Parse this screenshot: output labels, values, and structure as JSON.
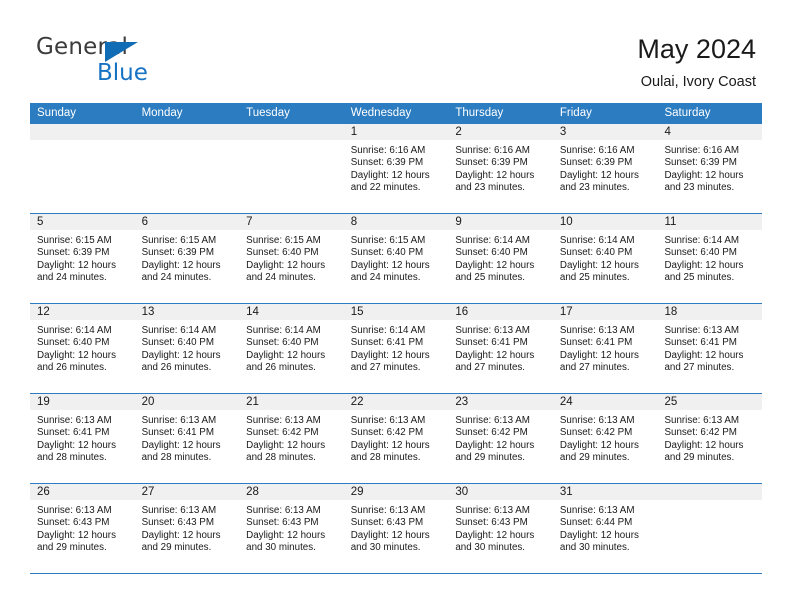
{
  "brand": {
    "line1": "General",
    "line2": "Blue",
    "accent_color": "#1673c4"
  },
  "header": {
    "title": "May 2024",
    "subtitle": "Oulai, Ivory Coast"
  },
  "theme": {
    "header_blue": "#2b7cc0",
    "band_gray": "#f0f0f0",
    "text": "#1a1a1a"
  },
  "weekdays": [
    "Sunday",
    "Monday",
    "Tuesday",
    "Wednesday",
    "Thursday",
    "Friday",
    "Saturday"
  ],
  "weeks": [
    [
      {
        "day": "",
        "lines": [
          "",
          "",
          "",
          ""
        ]
      },
      {
        "day": "",
        "lines": [
          "",
          "",
          "",
          ""
        ]
      },
      {
        "day": "",
        "lines": [
          "",
          "",
          "",
          ""
        ]
      },
      {
        "day": "1",
        "lines": [
          "Sunrise: 6:16 AM",
          "Sunset: 6:39 PM",
          "Daylight: 12 hours",
          "and 22 minutes."
        ]
      },
      {
        "day": "2",
        "lines": [
          "Sunrise: 6:16 AM",
          "Sunset: 6:39 PM",
          "Daylight: 12 hours",
          "and 23 minutes."
        ]
      },
      {
        "day": "3",
        "lines": [
          "Sunrise: 6:16 AM",
          "Sunset: 6:39 PM",
          "Daylight: 12 hours",
          "and 23 minutes."
        ]
      },
      {
        "day": "4",
        "lines": [
          "Sunrise: 6:16 AM",
          "Sunset: 6:39 PM",
          "Daylight: 12 hours",
          "and 23 minutes."
        ]
      }
    ],
    [
      {
        "day": "5",
        "lines": [
          "Sunrise: 6:15 AM",
          "Sunset: 6:39 PM",
          "Daylight: 12 hours",
          "and 24 minutes."
        ]
      },
      {
        "day": "6",
        "lines": [
          "Sunrise: 6:15 AM",
          "Sunset: 6:39 PM",
          "Daylight: 12 hours",
          "and 24 minutes."
        ]
      },
      {
        "day": "7",
        "lines": [
          "Sunrise: 6:15 AM",
          "Sunset: 6:40 PM",
          "Daylight: 12 hours",
          "and 24 minutes."
        ]
      },
      {
        "day": "8",
        "lines": [
          "Sunrise: 6:15 AM",
          "Sunset: 6:40 PM",
          "Daylight: 12 hours",
          "and 24 minutes."
        ]
      },
      {
        "day": "9",
        "lines": [
          "Sunrise: 6:14 AM",
          "Sunset: 6:40 PM",
          "Daylight: 12 hours",
          "and 25 minutes."
        ]
      },
      {
        "day": "10",
        "lines": [
          "Sunrise: 6:14 AM",
          "Sunset: 6:40 PM",
          "Daylight: 12 hours",
          "and 25 minutes."
        ]
      },
      {
        "day": "11",
        "lines": [
          "Sunrise: 6:14 AM",
          "Sunset: 6:40 PM",
          "Daylight: 12 hours",
          "and 25 minutes."
        ]
      }
    ],
    [
      {
        "day": "12",
        "lines": [
          "Sunrise: 6:14 AM",
          "Sunset: 6:40 PM",
          "Daylight: 12 hours",
          "and 26 minutes."
        ]
      },
      {
        "day": "13",
        "lines": [
          "Sunrise: 6:14 AM",
          "Sunset: 6:40 PM",
          "Daylight: 12 hours",
          "and 26 minutes."
        ]
      },
      {
        "day": "14",
        "lines": [
          "Sunrise: 6:14 AM",
          "Sunset: 6:40 PM",
          "Daylight: 12 hours",
          "and 26 minutes."
        ]
      },
      {
        "day": "15",
        "lines": [
          "Sunrise: 6:14 AM",
          "Sunset: 6:41 PM",
          "Daylight: 12 hours",
          "and 27 minutes."
        ]
      },
      {
        "day": "16",
        "lines": [
          "Sunrise: 6:13 AM",
          "Sunset: 6:41 PM",
          "Daylight: 12 hours",
          "and 27 minutes."
        ]
      },
      {
        "day": "17",
        "lines": [
          "Sunrise: 6:13 AM",
          "Sunset: 6:41 PM",
          "Daylight: 12 hours",
          "and 27 minutes."
        ]
      },
      {
        "day": "18",
        "lines": [
          "Sunrise: 6:13 AM",
          "Sunset: 6:41 PM",
          "Daylight: 12 hours",
          "and 27 minutes."
        ]
      }
    ],
    [
      {
        "day": "19",
        "lines": [
          "Sunrise: 6:13 AM",
          "Sunset: 6:41 PM",
          "Daylight: 12 hours",
          "and 28 minutes."
        ]
      },
      {
        "day": "20",
        "lines": [
          "Sunrise: 6:13 AM",
          "Sunset: 6:41 PM",
          "Daylight: 12 hours",
          "and 28 minutes."
        ]
      },
      {
        "day": "21",
        "lines": [
          "Sunrise: 6:13 AM",
          "Sunset: 6:42 PM",
          "Daylight: 12 hours",
          "and 28 minutes."
        ]
      },
      {
        "day": "22",
        "lines": [
          "Sunrise: 6:13 AM",
          "Sunset: 6:42 PM",
          "Daylight: 12 hours",
          "and 28 minutes."
        ]
      },
      {
        "day": "23",
        "lines": [
          "Sunrise: 6:13 AM",
          "Sunset: 6:42 PM",
          "Daylight: 12 hours",
          "and 29 minutes."
        ]
      },
      {
        "day": "24",
        "lines": [
          "Sunrise: 6:13 AM",
          "Sunset: 6:42 PM",
          "Daylight: 12 hours",
          "and 29 minutes."
        ]
      },
      {
        "day": "25",
        "lines": [
          "Sunrise: 6:13 AM",
          "Sunset: 6:42 PM",
          "Daylight: 12 hours",
          "and 29 minutes."
        ]
      }
    ],
    [
      {
        "day": "26",
        "lines": [
          "Sunrise: 6:13 AM",
          "Sunset: 6:43 PM",
          "Daylight: 12 hours",
          "and 29 minutes."
        ]
      },
      {
        "day": "27",
        "lines": [
          "Sunrise: 6:13 AM",
          "Sunset: 6:43 PM",
          "Daylight: 12 hours",
          "and 29 minutes."
        ]
      },
      {
        "day": "28",
        "lines": [
          "Sunrise: 6:13 AM",
          "Sunset: 6:43 PM",
          "Daylight: 12 hours",
          "and 30 minutes."
        ]
      },
      {
        "day": "29",
        "lines": [
          "Sunrise: 6:13 AM",
          "Sunset: 6:43 PM",
          "Daylight: 12 hours",
          "and 30 minutes."
        ]
      },
      {
        "day": "30",
        "lines": [
          "Sunrise: 6:13 AM",
          "Sunset: 6:43 PM",
          "Daylight: 12 hours",
          "and 30 minutes."
        ]
      },
      {
        "day": "31",
        "lines": [
          "Sunrise: 6:13 AM",
          "Sunset: 6:44 PM",
          "Daylight: 12 hours",
          "and 30 minutes."
        ]
      },
      {
        "day": "",
        "lines": [
          "",
          "",
          "",
          ""
        ]
      }
    ]
  ]
}
